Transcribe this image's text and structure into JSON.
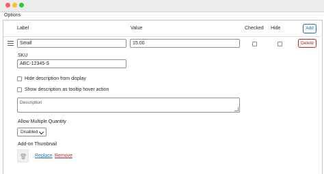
{
  "section": {
    "title": "Options"
  },
  "columns": {
    "label": "Label",
    "value": "Value",
    "checked": "Checked",
    "hide": "Hide",
    "add_button": "Add"
  },
  "row": {
    "label_value": "Small",
    "price_value": "15.00",
    "delete_button": "Delete",
    "sku_label": "SKU",
    "sku_value": "ABC-12345-S",
    "hide_description_label": "Hide description from display",
    "tooltip_description_label": "Show description as tooltip hover action",
    "description_placeholder": "Description",
    "multiple_quantity_label": "Allow Multiple Quantity",
    "multiple_quantity_value": "Disabled",
    "thumbnail_label": "Add-on Thumbnail",
    "replace_link": "Replace",
    "remove_link": "Remove"
  },
  "colors": {
    "accent": "#2271b1",
    "danger": "#b32d2e"
  }
}
